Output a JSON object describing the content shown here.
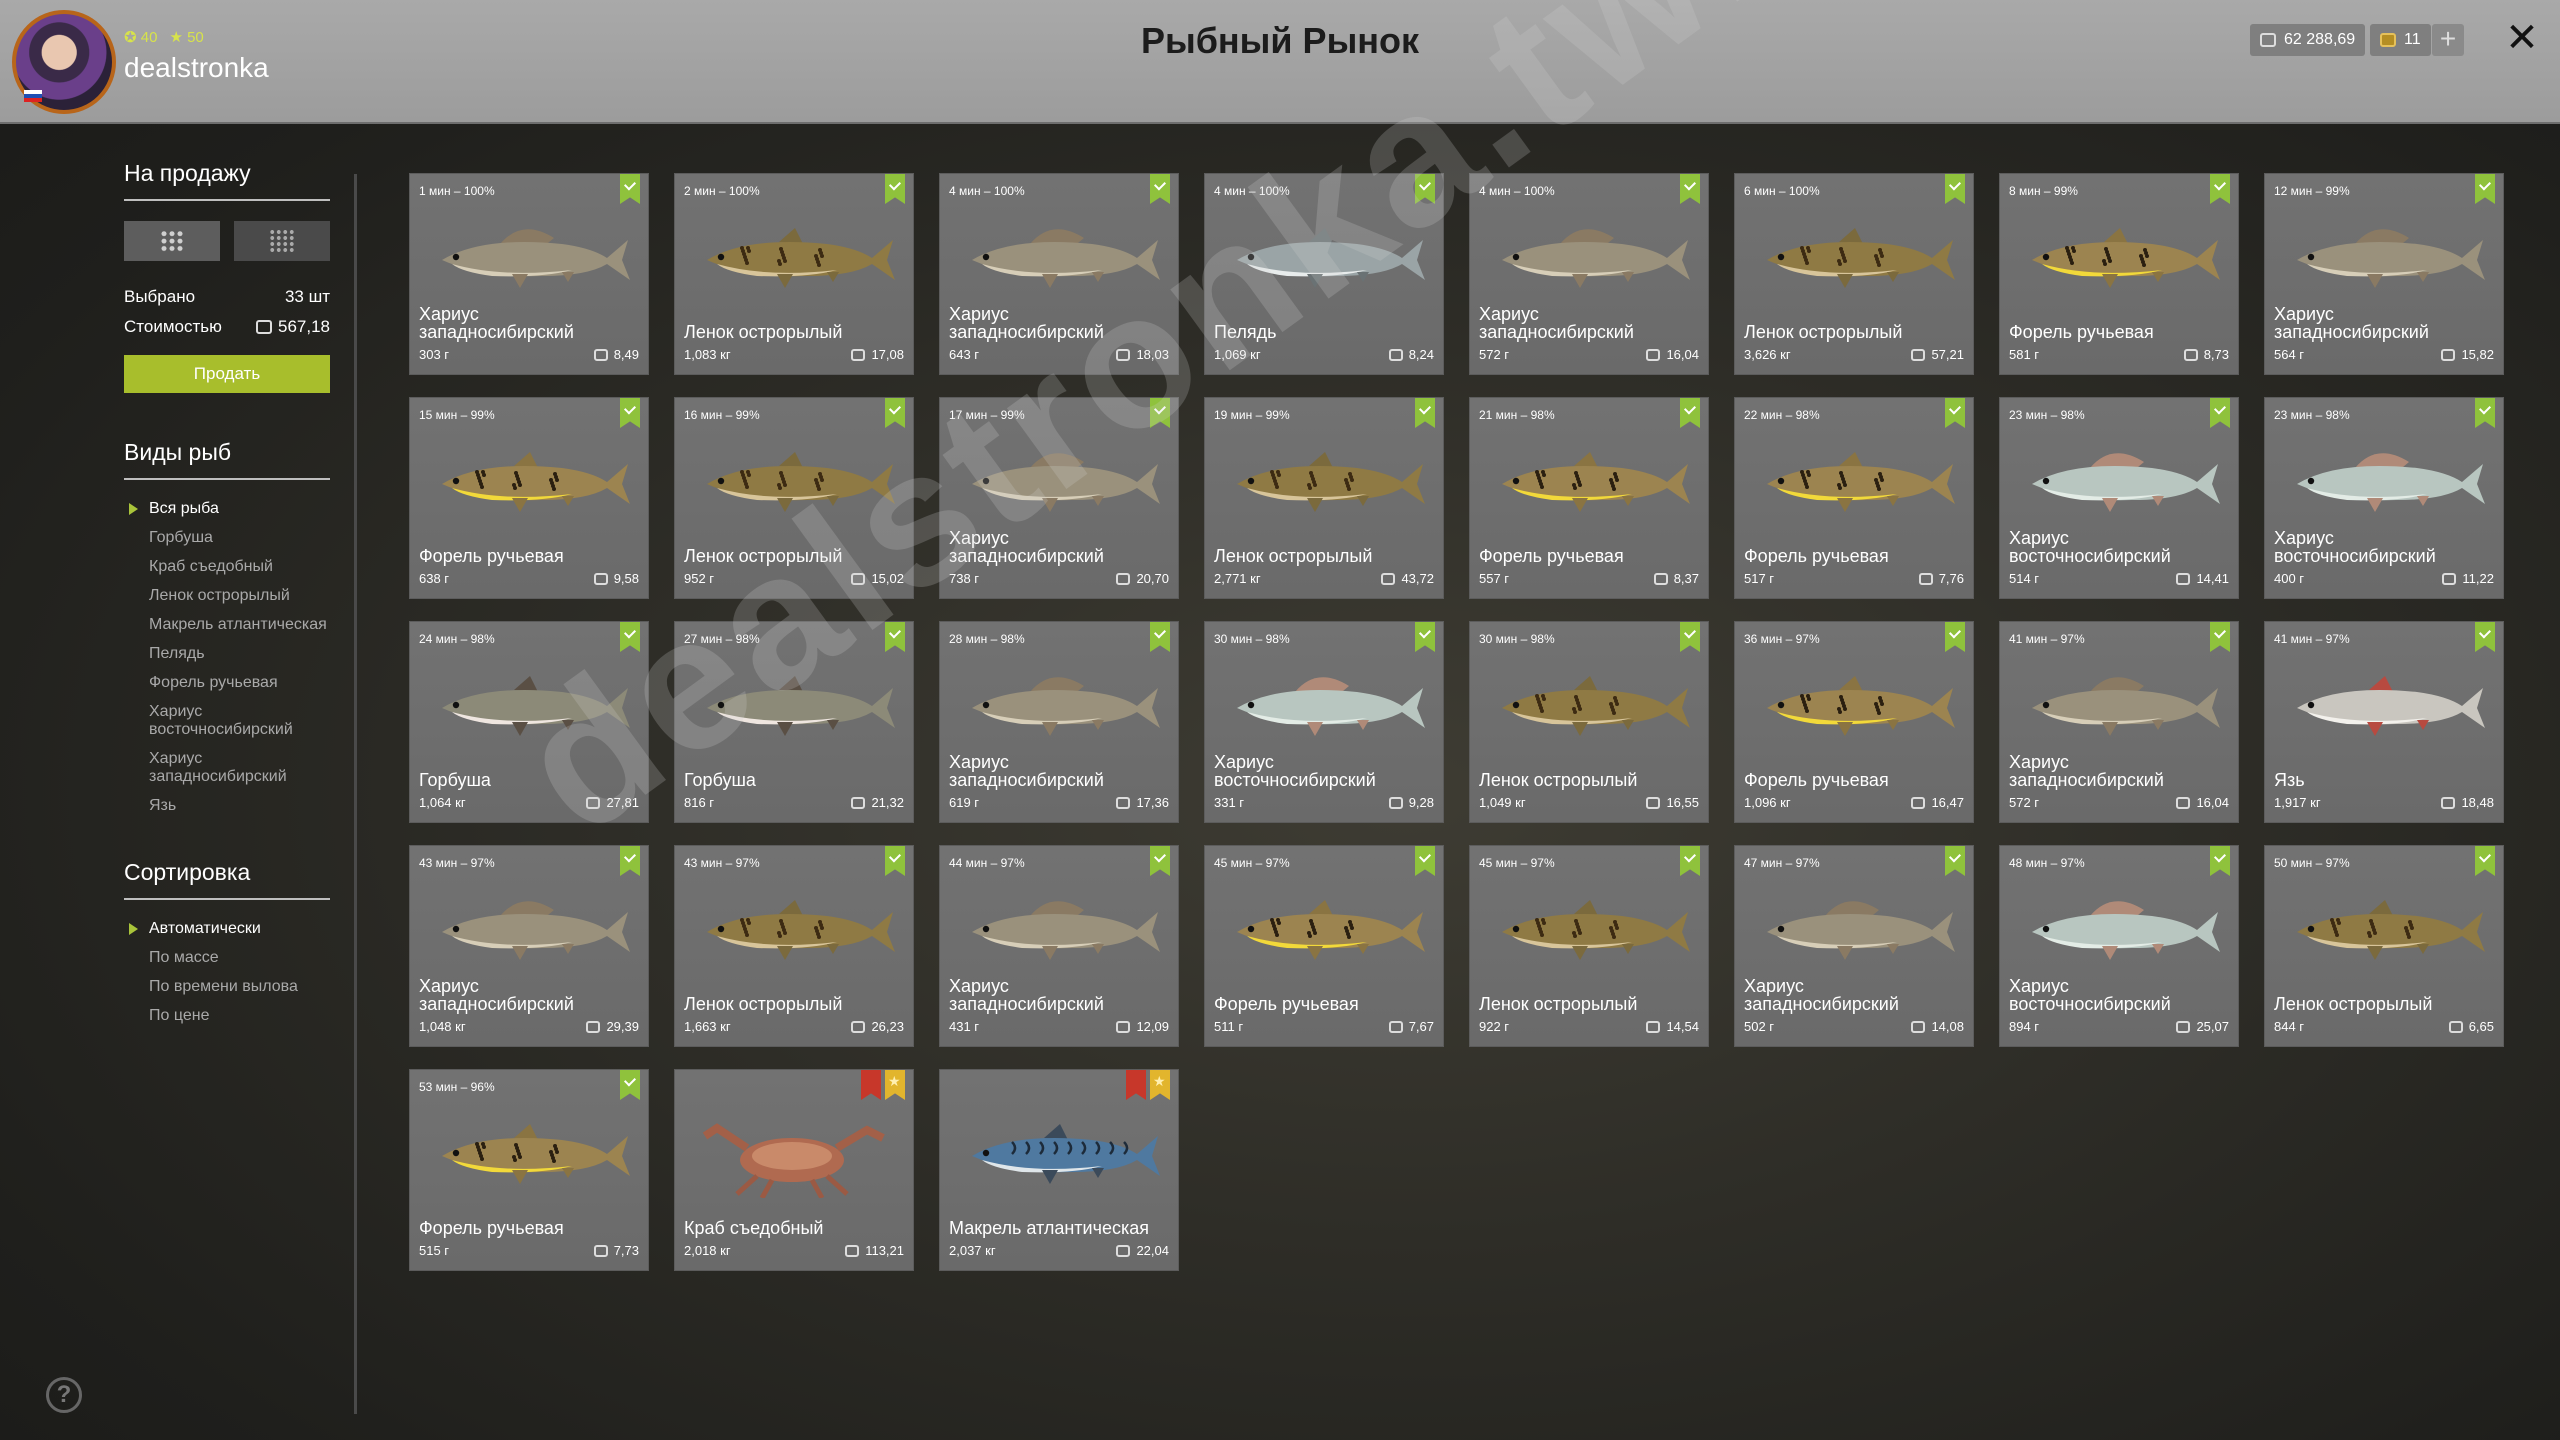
{
  "header": {
    "title": "Рыбный Рынок",
    "player": {
      "name": "dealstronka",
      "level_a": "40",
      "level_b": "50"
    },
    "silver": "62 288,69",
    "gold": "11"
  },
  "sidebar": {
    "for_sale_heading": "На продажу",
    "selected_label": "Выбрано",
    "selected_value": "33 шт",
    "cost_label": "Стоимостью",
    "cost_value": "567,18",
    "sell_label": "Продать",
    "species_heading": "Виды рыб",
    "species": [
      "Вся рыба",
      "Горбуша",
      "Краб съедобный",
      "Ленок острорылый",
      "Макрель атлантическая",
      "Пелядь",
      "Форель ручьевая",
      "Хариус восточносибирский",
      "Хариус западносибирский",
      "Язь"
    ],
    "sort_heading": "Сортировка",
    "sort": [
      "Автоматически",
      "По массе",
      "По времени вылова",
      "По цене"
    ]
  },
  "watermark": "dealstronka.twitch",
  "cards": [
    {
      "time": "1 мин – 100%",
      "name": "Хариус западносибирский",
      "weight": "303 г",
      "price": "8,49",
      "fish": "grayling"
    },
    {
      "time": "2 мин – 100%",
      "name": "Ленок острорылый",
      "weight": "1,083 кг",
      "price": "17,08",
      "fish": "lenok"
    },
    {
      "time": "4 мин – 100%",
      "name": "Хариус западносибирский",
      "weight": "643 г",
      "price": "18,03",
      "fish": "grayling"
    },
    {
      "time": "4 мин – 100%",
      "name": "Пелядь",
      "weight": "1,069 кг",
      "price": "8,24",
      "fish": "peled"
    },
    {
      "time": "4 мин – 100%",
      "name": "Хариус западносибирский",
      "weight": "572 г",
      "price": "16,04",
      "fish": "grayling"
    },
    {
      "time": "6 мин – 100%",
      "name": "Ленок острорылый",
      "weight": "3,626 кг",
      "price": "57,21",
      "fish": "lenok"
    },
    {
      "time": "8 мин – 99%",
      "name": "Форель ручьевая",
      "weight": "581 г",
      "price": "8,73",
      "fish": "trout"
    },
    {
      "time": "12 мин – 99%",
      "name": "Хариус западносибирский",
      "weight": "564 г",
      "price": "15,82",
      "fish": "grayling"
    },
    {
      "time": "15 мин – 99%",
      "name": "Форель ручьевая",
      "weight": "638 г",
      "price": "9,58",
      "fish": "trout"
    },
    {
      "time": "16 мин – 99%",
      "name": "Ленок острорылый",
      "weight": "952 г",
      "price": "15,02",
      "fish": "lenok"
    },
    {
      "time": "17 мин – 99%",
      "name": "Хариус западносибирский",
      "weight": "738 г",
      "price": "20,70",
      "fish": "grayling"
    },
    {
      "time": "19 мин – 99%",
      "name": "Ленок острорылый",
      "weight": "2,771 кг",
      "price": "43,72",
      "fish": "lenok"
    },
    {
      "time": "21 мин – 98%",
      "name": "Форель ручьевая",
      "weight": "557 г",
      "price": "8,37",
      "fish": "trout"
    },
    {
      "time": "22 мин – 98%",
      "name": "Форель ручьевая",
      "weight": "517 г",
      "price": "7,76",
      "fish": "trout"
    },
    {
      "time": "23 мин – 98%",
      "name": "Хариус восточносибирский",
      "weight": "514 г",
      "price": "14,41",
      "fish": "egrayling"
    },
    {
      "time": "23 мин – 98%",
      "name": "Хариус восточносибирский",
      "weight": "400 г",
      "price": "11,22",
      "fish": "egrayling"
    },
    {
      "time": "24 мин – 98%",
      "name": "Горбуша",
      "weight": "1,064 кг",
      "price": "27,81",
      "fish": "salmon"
    },
    {
      "time": "27 мин – 98%",
      "name": "Горбуша",
      "weight": "816 г",
      "price": "21,32",
      "fish": "salmon"
    },
    {
      "time": "28 мин – 98%",
      "name": "Хариус западносибирский",
      "weight": "619 г",
      "price": "17,36",
      "fish": "grayling"
    },
    {
      "time": "30 мин – 98%",
      "name": "Хариус восточносибирский",
      "weight": "331 г",
      "price": "9,28",
      "fish": "egrayling"
    },
    {
      "time": "30 мин – 98%",
      "name": "Ленок острорылый",
      "weight": "1,049 кг",
      "price": "16,55",
      "fish": "lenok"
    },
    {
      "time": "36 мин – 97%",
      "name": "Форель ручьевая",
      "weight": "1,096 кг",
      "price": "16,47",
      "fish": "trout"
    },
    {
      "time": "41 мин – 97%",
      "name": "Хариус западносибирский",
      "weight": "572 г",
      "price": "16,04",
      "fish": "grayling"
    },
    {
      "time": "41 мин – 97%",
      "name": "Язь",
      "weight": "1,917 кг",
      "price": "18,48",
      "fish": "ide"
    },
    {
      "time": "43 мин – 97%",
      "name": "Хариус западносибирский",
      "weight": "1,048 кг",
      "price": "29,39",
      "fish": "grayling"
    },
    {
      "time": "43 мин – 97%",
      "name": "Ленок острорылый",
      "weight": "1,663 кг",
      "price": "26,23",
      "fish": "lenok"
    },
    {
      "time": "44 мин – 97%",
      "name": "Хариус западносибирский",
      "weight": "431 г",
      "price": "12,09",
      "fish": "grayling"
    },
    {
      "time": "45 мин – 97%",
      "name": "Форель ручьевая",
      "weight": "511 г",
      "price": "7,67",
      "fish": "trout"
    },
    {
      "time": "45 мин – 97%",
      "name": "Ленок острорылый",
      "weight": "922 г",
      "price": "14,54",
      "fish": "lenok"
    },
    {
      "time": "47 мин – 97%",
      "name": "Хариус западносибирский",
      "weight": "502 г",
      "price": "14,08",
      "fish": "grayling"
    },
    {
      "time": "48 мин – 97%",
      "name": "Хариус восточносибирский",
      "weight": "894 г",
      "price": "25,07",
      "fish": "egrayling"
    },
    {
      "time": "50 мин – 97%",
      "name": "Ленок острорылый",
      "weight": "844 г",
      "price": "6,65",
      "fish": "lenok"
    },
    {
      "time": "53 мин – 96%",
      "name": "Форель ручьевая",
      "weight": "515 г",
      "price": "7,73",
      "fish": "trout"
    },
    {
      "time": "",
      "name": "Краб съедобный",
      "weight": "2,018 кг",
      "price": "113,21",
      "fish": "crab",
      "special": true
    },
    {
      "time": "",
      "name": "Макрель атлантическая",
      "weight": "2,037 кг",
      "price": "22,04",
      "fish": "mackerel",
      "special": true
    }
  ]
}
